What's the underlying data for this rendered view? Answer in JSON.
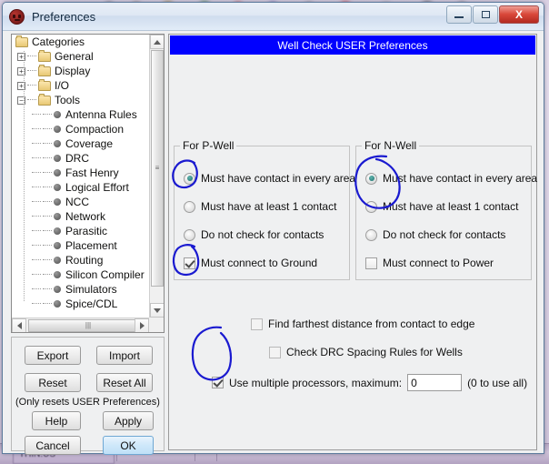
{
  "window": {
    "title": "Preferences",
    "app_icon": "electric-app-icon",
    "controls": {
      "minimize": "minimize-icon",
      "maximize": "maximize-icon",
      "close": "X"
    }
  },
  "taskbar": {
    "button_label": "THIN:US"
  },
  "sidebar": {
    "tree_root": "Categories",
    "nodes": [
      {
        "label": "Categories",
        "type": "root",
        "depth": 0,
        "expander": ""
      },
      {
        "label": "General",
        "type": "folder",
        "depth": 1,
        "expander": "+"
      },
      {
        "label": "Display",
        "type": "folder",
        "depth": 1,
        "expander": "+"
      },
      {
        "label": "I/O",
        "type": "folder",
        "depth": 1,
        "expander": "+"
      },
      {
        "label": "Tools",
        "type": "folder",
        "depth": 1,
        "expander": "−"
      },
      {
        "label": "Antenna Rules",
        "type": "leaf",
        "depth": 2,
        "expander": ""
      },
      {
        "label": "Compaction",
        "type": "leaf",
        "depth": 2,
        "expander": ""
      },
      {
        "label": "Coverage",
        "type": "leaf",
        "depth": 2,
        "expander": ""
      },
      {
        "label": "DRC",
        "type": "leaf",
        "depth": 2,
        "expander": ""
      },
      {
        "label": "Fast Henry",
        "type": "leaf",
        "depth": 2,
        "expander": ""
      },
      {
        "label": "Logical Effort",
        "type": "leaf",
        "depth": 2,
        "expander": ""
      },
      {
        "label": "NCC",
        "type": "leaf",
        "depth": 2,
        "expander": ""
      },
      {
        "label": "Network",
        "type": "leaf",
        "depth": 2,
        "expander": ""
      },
      {
        "label": "Parasitic",
        "type": "leaf",
        "depth": 2,
        "expander": ""
      },
      {
        "label": "Placement",
        "type": "leaf",
        "depth": 2,
        "expander": ""
      },
      {
        "label": "Routing",
        "type": "leaf",
        "depth": 2,
        "expander": ""
      },
      {
        "label": "Silicon Compiler",
        "type": "leaf",
        "depth": 2,
        "expander": ""
      },
      {
        "label": "Simulators",
        "type": "leaf",
        "depth": 2,
        "expander": ""
      },
      {
        "label": "Spice/CDL",
        "type": "leaf",
        "depth": 2,
        "expander": ""
      }
    ],
    "scrollbars": {
      "up_arrow": "scroll-up-icon",
      "down_arrow": "scroll-down-icon",
      "left_arrow": "scroll-left-icon",
      "right_arrow": "scroll-right-icon",
      "grip": "|||"
    }
  },
  "buttons": {
    "export": "Export",
    "import": "Import",
    "reset": "Reset",
    "reset_all": "Reset All",
    "reset_note": "(Only resets USER Preferences)",
    "help": "Help",
    "apply": "Apply",
    "cancel": "Cancel",
    "ok": "OK"
  },
  "main": {
    "header": "Well Check USER Preferences",
    "header_color": "#0000ff",
    "pwell": {
      "label": "For P-Well",
      "options": [
        {
          "label": "Must have contact in every area",
          "selected": true
        },
        {
          "label": "Must have at least 1 contact",
          "selected": false
        },
        {
          "label": "Do not check for contacts",
          "selected": false
        }
      ],
      "checkbox": {
        "label": "Must connect to Ground",
        "checked": true
      }
    },
    "nwell": {
      "label": "For N-Well",
      "options": [
        {
          "label": "Must have contact in every area",
          "selected": true
        },
        {
          "label": "Must have at least 1 contact",
          "selected": false
        },
        {
          "label": "Do not check for contacts",
          "selected": false
        }
      ],
      "checkbox": {
        "label": "Must connect to Power",
        "checked": false
      }
    },
    "options": [
      {
        "label": "Find farthest distance from contact to edge",
        "checked": false
      },
      {
        "label": "Check DRC Spacing Rules for Wells",
        "checked": false
      }
    ],
    "processors": {
      "label": "Use multiple processors, maximum:",
      "checked": true,
      "value": "0",
      "placeholder": "",
      "note": "(0 to use all)"
    }
  },
  "annotations": {
    "ink_color": "#1a1ad0",
    "marks": [
      "circle-pwell-first-radio",
      "circle-pwell-ground-checkbox",
      "circle-nwell-first-radio",
      "circle-use-multiple-processors-checkbox"
    ]
  }
}
